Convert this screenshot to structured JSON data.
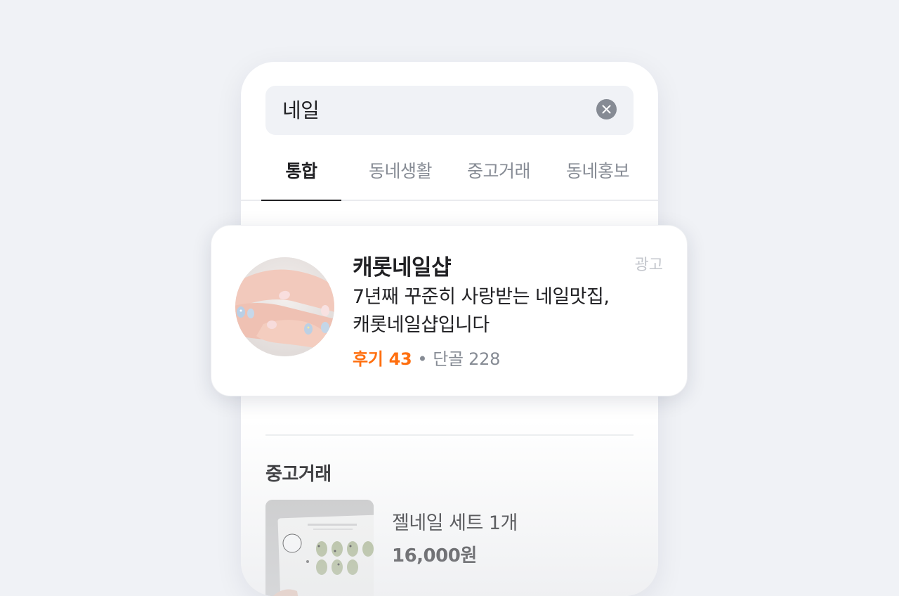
{
  "search": {
    "query": "네일"
  },
  "tabs": [
    {
      "label": "통합",
      "active": true
    },
    {
      "label": "동네생활",
      "active": false
    },
    {
      "label": "중고거래",
      "active": false
    },
    {
      "label": "동네홍보",
      "active": false
    }
  ],
  "ad_card": {
    "name": "캐롯네일샵",
    "ad_label": "광고",
    "description_line1": "7년째 꾸준히 사랑받는 네일맛집,",
    "description_line2": "캐롯네일샵입니다",
    "review_text": "후기 43",
    "separator": "•",
    "regulars_text": "단골 228"
  },
  "used_market": {
    "section_title": "중고거래",
    "items": [
      {
        "title": "젤네일 세트 1개",
        "price": "16,000원"
      }
    ]
  },
  "colors": {
    "accent_orange": "#ff6f0f",
    "text_primary": "#212124",
    "text_secondary": "#868b94",
    "page_background": "#f0f2f6"
  }
}
